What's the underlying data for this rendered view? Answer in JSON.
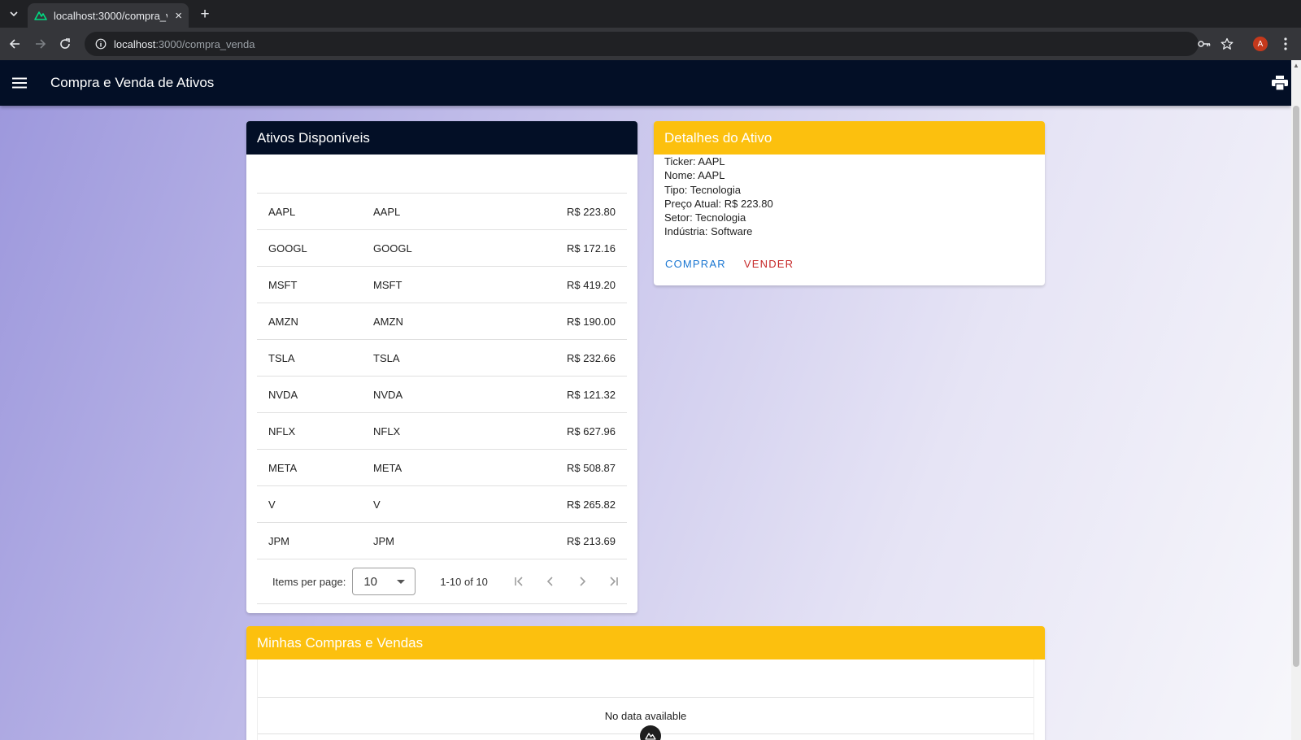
{
  "browser": {
    "tab_title": "localhost:3000/compra_venda",
    "url_host": "localhost",
    "url_path": ":3000/compra_venda",
    "profile_initial": "A"
  },
  "app": {
    "title": "Compra e Venda de Ativos"
  },
  "ativos": {
    "title": "Ativos Disponíveis",
    "rows": [
      {
        "ticker": "AAPL",
        "name": "AAPL",
        "price": "R$ 223.80"
      },
      {
        "ticker": "GOOGL",
        "name": "GOOGL",
        "price": "R$ 172.16"
      },
      {
        "ticker": "MSFT",
        "name": "MSFT",
        "price": "R$ 419.20"
      },
      {
        "ticker": "AMZN",
        "name": "AMZN",
        "price": "R$ 190.00"
      },
      {
        "ticker": "TSLA",
        "name": "TSLA",
        "price": "R$ 232.66"
      },
      {
        "ticker": "NVDA",
        "name": "NVDA",
        "price": "R$ 121.32"
      },
      {
        "ticker": "NFLX",
        "name": "NFLX",
        "price": "R$ 627.96"
      },
      {
        "ticker": "META",
        "name": "META",
        "price": "R$ 508.87"
      },
      {
        "ticker": "V",
        "name": "V",
        "price": "R$ 265.82"
      },
      {
        "ticker": "JPM",
        "name": "JPM",
        "price": "R$ 213.69"
      }
    ],
    "pagination": {
      "items_per_page_label": "Items per page:",
      "items_per_page_value": "10",
      "range_text": "1-10 of 10"
    }
  },
  "detalhes": {
    "title": "Detalhes do Ativo",
    "ticker": "Ticker: AAPL",
    "nome": "Nome: AAPL",
    "tipo": "Tipo: Tecnologia",
    "preco": "Preço Atual: R$ 223.80",
    "setor": "Setor: Tecnologia",
    "industria": "Indústria: Software",
    "buy_label": "COMPRAR",
    "sell_label": "VENDER"
  },
  "minhas": {
    "title": "Minhas Compras e Vendas",
    "empty_text": "No data available"
  },
  "colors": {
    "appbar": "#030f26",
    "amber_header": "#fcc00e",
    "buy": "#1976d2",
    "sell": "#c62828"
  }
}
